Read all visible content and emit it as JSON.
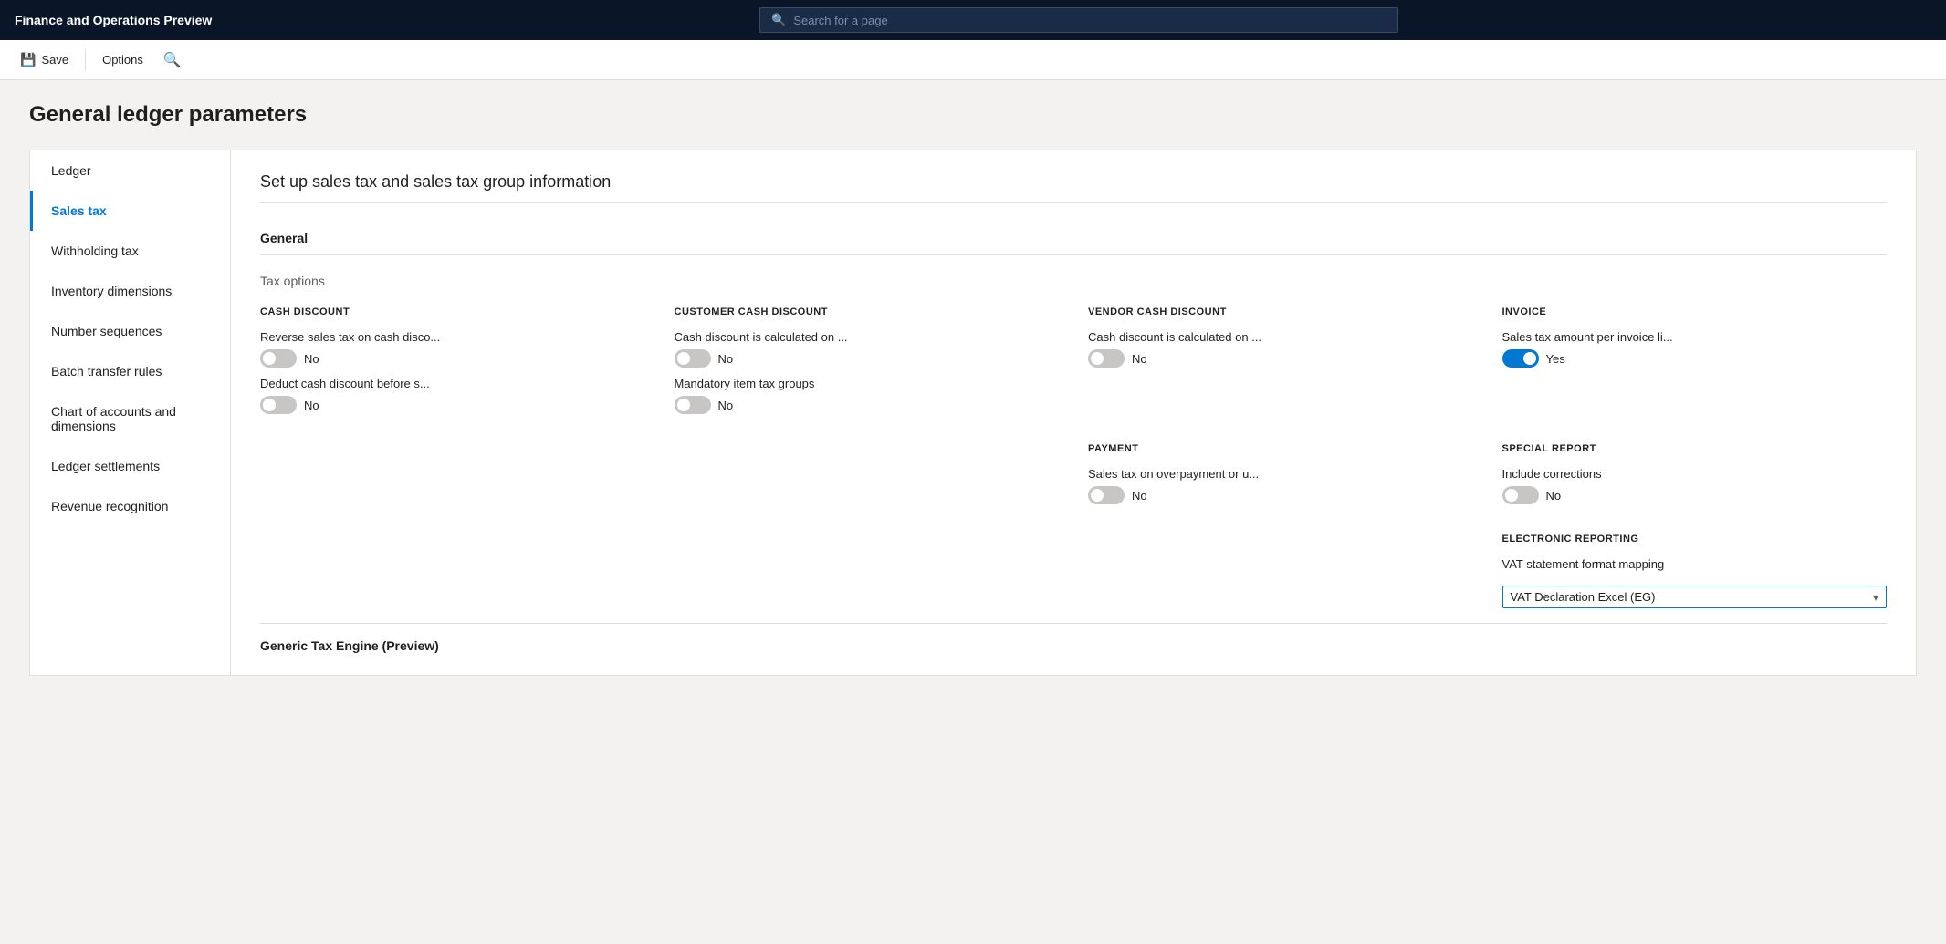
{
  "app": {
    "title": "Finance and Operations Preview"
  },
  "search": {
    "placeholder": "Search for a page"
  },
  "toolbar": {
    "save_label": "Save",
    "options_label": "Options"
  },
  "page": {
    "title": "General ledger parameters"
  },
  "nav": {
    "items": [
      {
        "id": "ledger",
        "label": "Ledger",
        "active": false
      },
      {
        "id": "sales-tax",
        "label": "Sales tax",
        "active": true
      },
      {
        "id": "withholding-tax",
        "label": "Withholding tax",
        "active": false
      },
      {
        "id": "inventory-dimensions",
        "label": "Inventory dimensions",
        "active": false
      },
      {
        "id": "number-sequences",
        "label": "Number sequences",
        "active": false
      },
      {
        "id": "batch-transfer-rules",
        "label": "Batch transfer rules",
        "active": false
      },
      {
        "id": "chart-of-accounts",
        "label": "Chart of accounts and dimensions",
        "active": false
      },
      {
        "id": "ledger-settlements",
        "label": "Ledger settlements",
        "active": false
      },
      {
        "id": "revenue-recognition",
        "label": "Revenue recognition",
        "active": false
      }
    ]
  },
  "main": {
    "section_title": "Set up sales tax and sales tax group information",
    "subsection": "General",
    "tax_options_label": "Tax options",
    "option_groups": [
      {
        "title": "CASH DISCOUNT",
        "toggles": [
          {
            "label": "Reverse sales tax on cash disco...",
            "value": "No",
            "on": false
          },
          {
            "label": "Deduct cash discount before s...",
            "value": "No",
            "on": false
          }
        ]
      },
      {
        "title": "CUSTOMER CASH DISCOUNT",
        "toggles": [
          {
            "label": "Cash discount is calculated on ...",
            "value": "No",
            "on": false
          },
          {
            "label": "Mandatory item tax groups",
            "value": "No",
            "on": false
          }
        ]
      },
      {
        "title": "VENDOR CASH DISCOUNT",
        "toggles": [
          {
            "label": "Cash discount is calculated on ...",
            "value": "No",
            "on": false
          }
        ]
      },
      {
        "title": "INVOICE",
        "toggles": [
          {
            "label": "Sales tax amount per invoice li...",
            "value": "Yes",
            "on": true
          }
        ]
      }
    ],
    "option_groups_row2": [
      {
        "title": "PAYMENT",
        "toggles": [
          {
            "label": "Sales tax on overpayment or u...",
            "value": "No",
            "on": false
          }
        ]
      },
      {
        "title": "SPECIAL REPORT",
        "toggles": [
          {
            "label": "Include corrections",
            "value": "No",
            "on": false
          }
        ]
      }
    ],
    "electronic_reporting": {
      "title": "ELECTRONIC REPORTING",
      "vat_label": "VAT statement format mapping",
      "vat_value": "VAT Declaration Excel (EG)"
    },
    "generic_tax_engine": {
      "title": "Generic Tax Engine (Preview)"
    }
  }
}
